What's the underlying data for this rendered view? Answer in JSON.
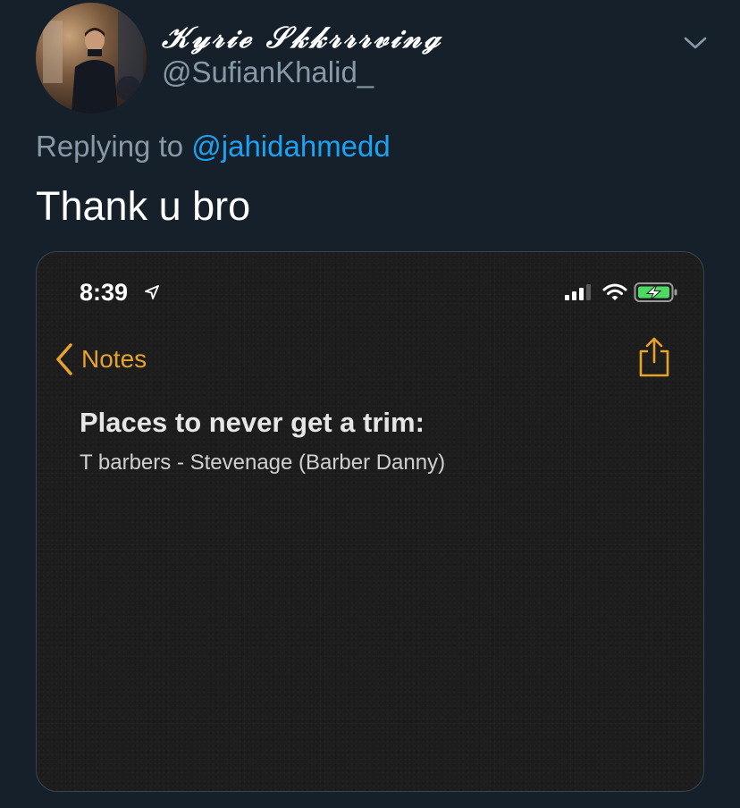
{
  "tweet": {
    "display_name": "𝒦𝓎𝓇𝒾ℯ 𝒮𝓀𝓀𝓇𝓇𝓇𝓋𝒾𝓃ℊ",
    "handle": "@SufianKhalid_",
    "reply_prefix": "Replying to ",
    "reply_mention": "@jahidahmedd",
    "text": "Thank u bro",
    "menu_icon": "chevron-down-icon"
  },
  "screenshot": {
    "status_bar": {
      "time": "8:39",
      "icons": [
        "location-arrow-icon",
        "cellular-signal-icon",
        "wifi-icon",
        "battery-charging-icon"
      ]
    },
    "nav": {
      "back_label": "Notes",
      "back_icon": "chevron-left-icon",
      "action_icon": "share-icon"
    },
    "note": {
      "title": "Places to never get a trim:",
      "body": "T barbers - Stevenage (Barber Danny)"
    }
  },
  "colors": {
    "background": "#15202b",
    "link": "#1da1f2",
    "secondary_text": "#8899a6",
    "notes_accent": "#e5a22d",
    "battery_green": "#4cd964"
  }
}
